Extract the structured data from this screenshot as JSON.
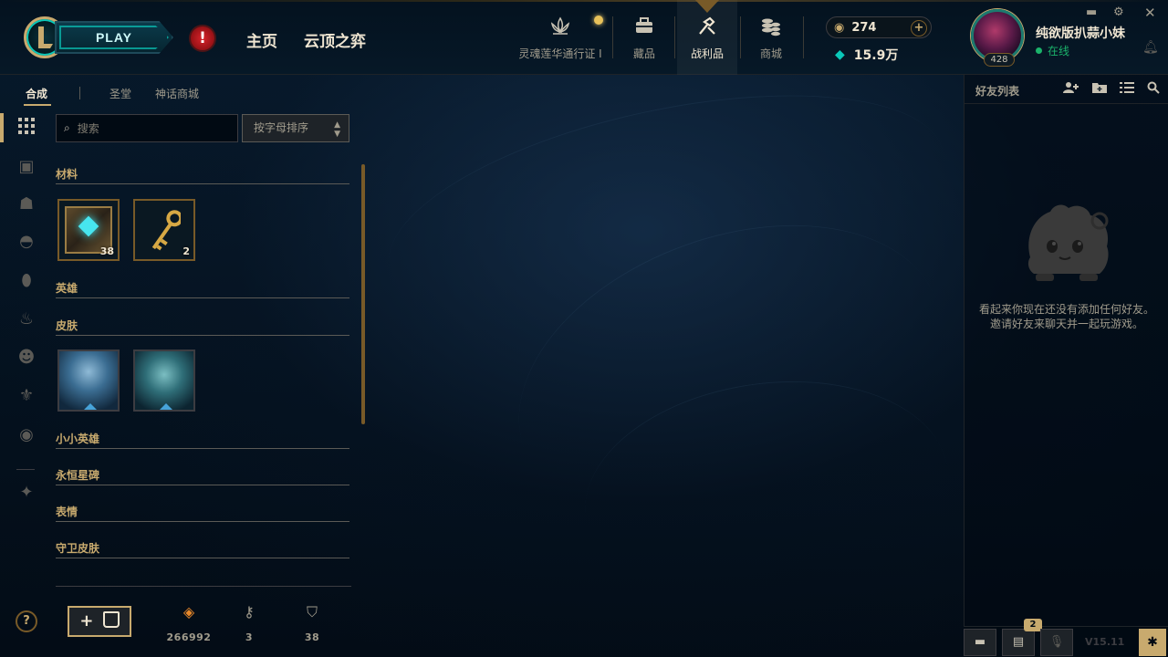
{
  "topbar": {
    "play_label": "PLAY",
    "alert_glyph": "!",
    "nav_home": "主页",
    "nav_tft": "云顶之弈",
    "icons": {
      "pass": {
        "label": "灵魂莲华通行证 I",
        "icon": "lotus-icon"
      },
      "collection": {
        "label": "藏品",
        "icon": "briefcase-icon"
      },
      "loot": {
        "label": "战利品",
        "icon": "loot-icon"
      },
      "store": {
        "label": "商城",
        "icon": "coins-icon"
      }
    },
    "rp": "274",
    "be": "15.9万",
    "summoner_name": "纯欲版扒蒜小妹",
    "status": "在线",
    "level": "428"
  },
  "subtabs": {
    "craft": "合成",
    "sanctum": "圣堂",
    "mythic": "神话商城"
  },
  "loot": {
    "search_placeholder": "搜索",
    "sort_label": "按字母排序",
    "categories": {
      "materials": "材料",
      "champions": "英雄",
      "skins": "皮肤",
      "little_legends": "小小英雄",
      "eternals": "永恒星碑",
      "emotes": "表情",
      "ward_skins": "守卫皮肤"
    },
    "items": {
      "chest_count": "38",
      "key_count": "2"
    },
    "footer": {
      "add_chest_label": "+",
      "essence": "266992",
      "keys": "3",
      "chests": "38"
    }
  },
  "friends": {
    "title": "好友列表",
    "empty_text": "看起来你现在还没有添加任何好友。邀请好友来聊天并一起玩游戏。"
  },
  "bottom": {
    "rooms_badge": "2",
    "version": "V15.11"
  },
  "colors": {
    "gold": "#c8aa6e",
    "teal": "#0ac8b9",
    "online": "#1bb36b",
    "alert": "#d8242b"
  }
}
